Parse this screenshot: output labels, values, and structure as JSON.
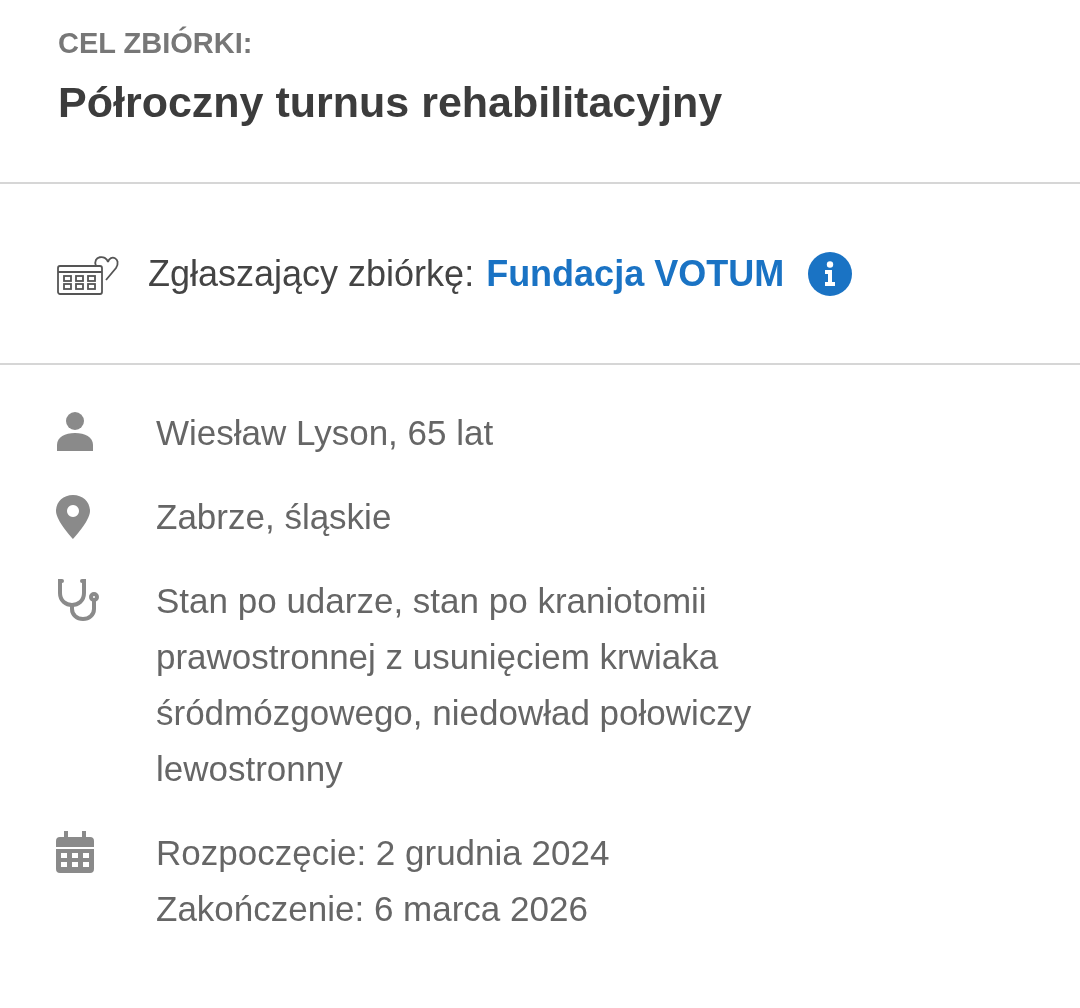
{
  "goal": {
    "label": "CEL ZBIÓRKI:",
    "title": "Półroczny turnus rehabilitacyjny"
  },
  "organizer": {
    "label": "Zgłaszający zbiórkę:",
    "name": "Fundacja VOTUM"
  },
  "details": [
    {
      "kind": "person",
      "lines": [
        "Wiesław Lyson, 65 lat"
      ]
    },
    {
      "kind": "location",
      "lines": [
        "Zabrze, śląskie"
      ]
    },
    {
      "kind": "diagnosis",
      "lines": [
        "Stan po udarze, stan po kraniotomii prawostronnej z usunięciem krwiaka śródmózgowego, niedowład połowiczy lewostronny"
      ]
    },
    {
      "kind": "dates",
      "lines": [
        "Rozpoczęcie: 2 grudnia 2024",
        "Zakończenie: 6 marca 2026"
      ]
    }
  ]
}
